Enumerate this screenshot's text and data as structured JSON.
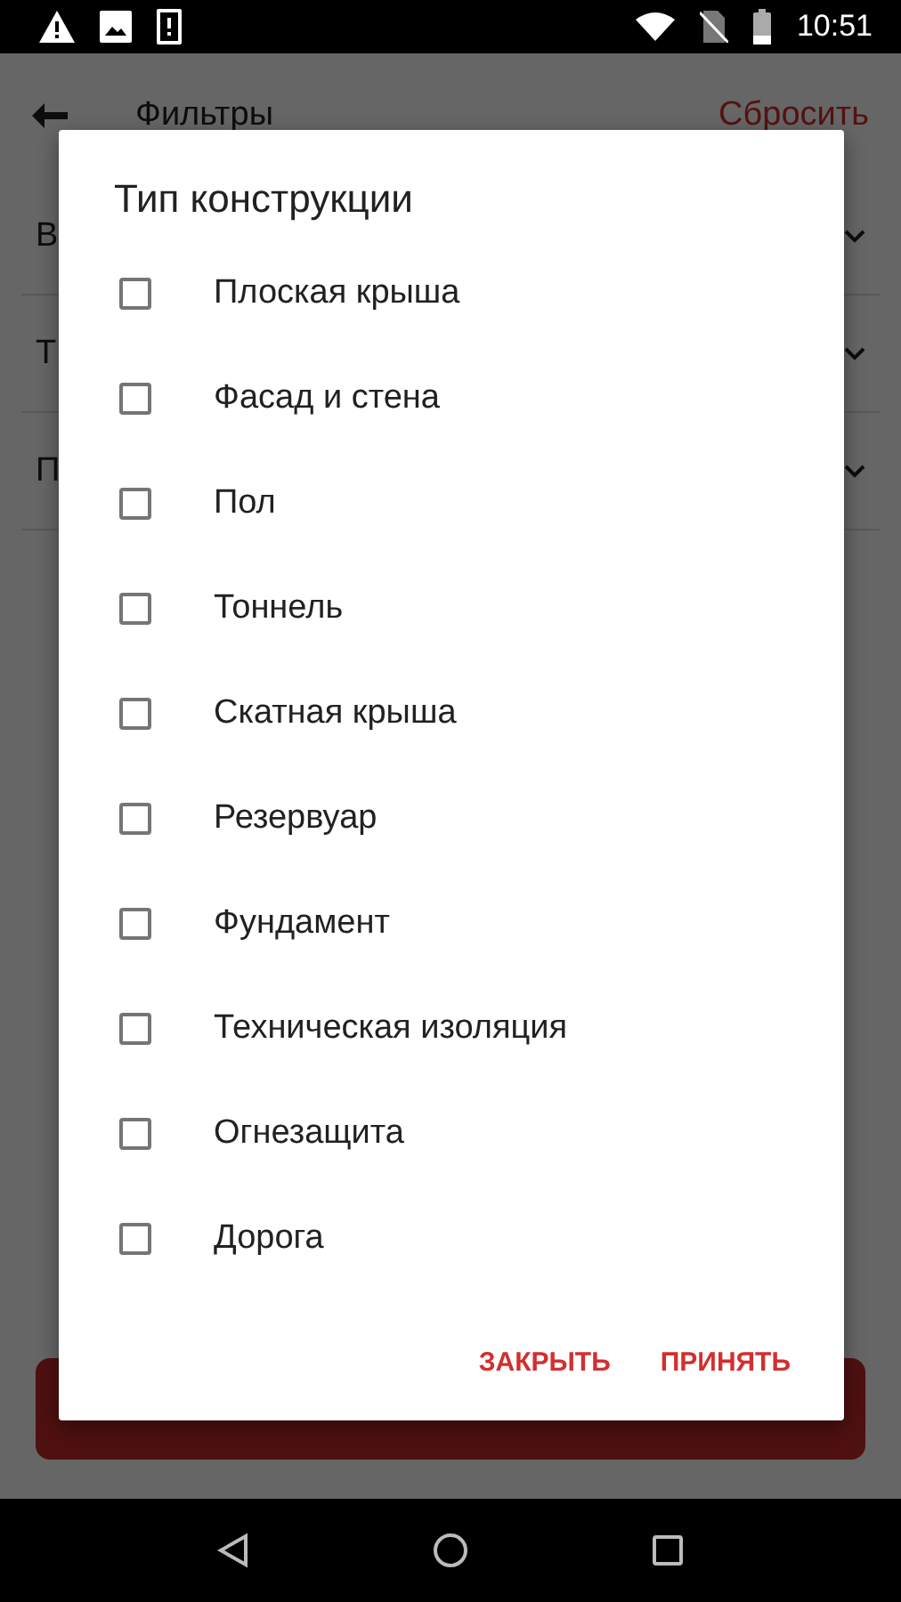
{
  "status_bar": {
    "time": "10:51"
  },
  "toolbar": {
    "title": "Фильтры",
    "action": "Сбросить"
  },
  "filter_rows": [
    {
      "label": "В"
    },
    {
      "label": "Т"
    },
    {
      "label": "П"
    }
  ],
  "dialog": {
    "title": "Тип конструкции",
    "options": [
      {
        "label": "Плоская крыша",
        "checked": false
      },
      {
        "label": "Фасад и стена",
        "checked": false
      },
      {
        "label": "Пол",
        "checked": false
      },
      {
        "label": "Тоннель",
        "checked": false
      },
      {
        "label": "Скатная крыша",
        "checked": false
      },
      {
        "label": "Резервуар",
        "checked": false
      },
      {
        "label": "Фундамент",
        "checked": false
      },
      {
        "label": "Техническая изоляция",
        "checked": false
      },
      {
        "label": "Огнезащита",
        "checked": false
      },
      {
        "label": "Дорога",
        "checked": false
      }
    ],
    "buttons": [
      "ЗАКРЫТЬ",
      "ПРИНЯТЬ"
    ]
  }
}
